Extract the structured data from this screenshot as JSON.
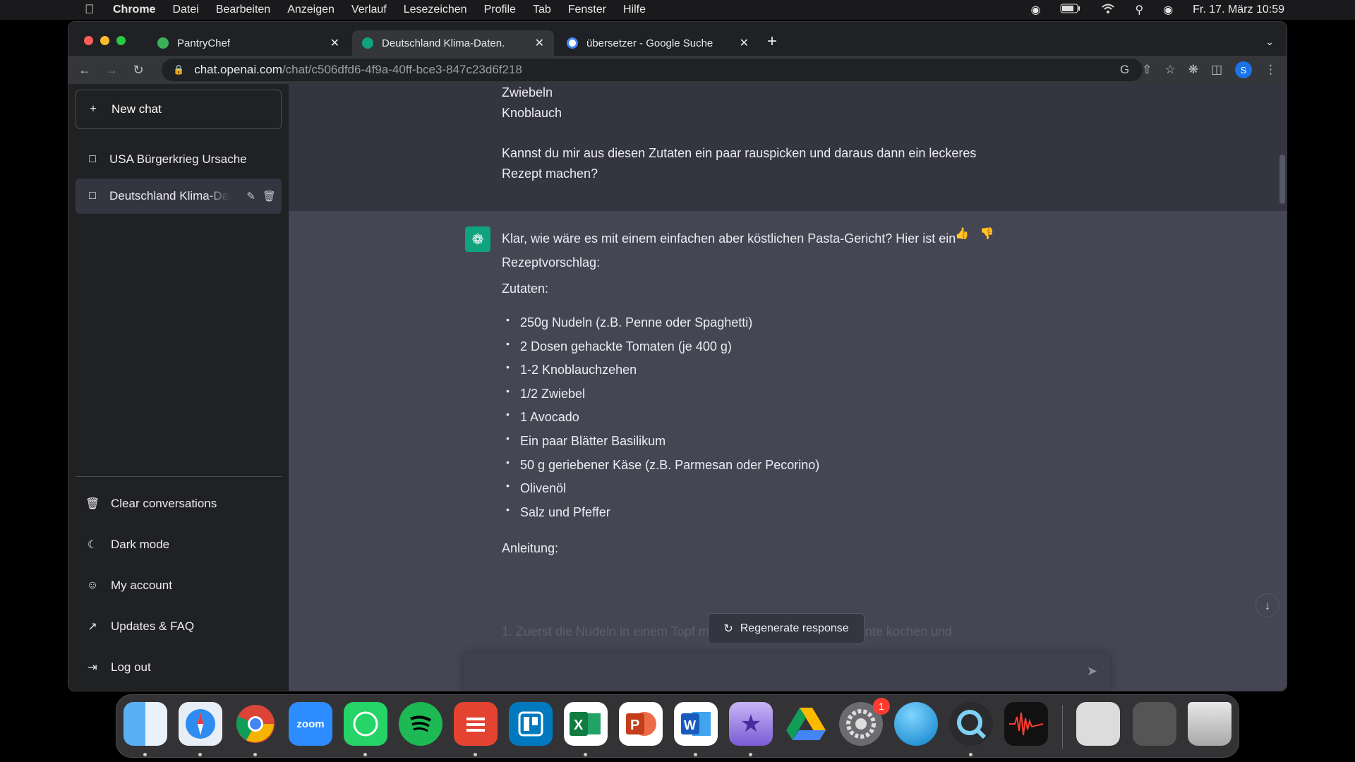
{
  "menubar": {
    "app": "Chrome",
    "menus": [
      "Datei",
      "Bearbeiten",
      "Anzeigen",
      "Verlauf",
      "Lesezeichen",
      "Profile",
      "Tab",
      "Fenster",
      "Hilfe"
    ],
    "datetime": "Fr. 17. März  10:59"
  },
  "tabs": [
    {
      "title": "PantryChef",
      "favicon_color": "#3bb05a"
    },
    {
      "title": "Deutschland Klima-Daten.",
      "favicon_color": "#10a37f"
    },
    {
      "title": "übersetzer - Google Suche",
      "favicon_color": "#ffffff"
    }
  ],
  "toolbar": {
    "url_host": "chat.openai.com",
    "url_path": "/chat/c506dfd6-4f9a-40ff-bce3-847c23d6f218",
    "profile_initial": "S"
  },
  "sidebar": {
    "new_chat": "New chat",
    "conversations": [
      "USA Bürgerkrieg Ursache",
      "Deutschland Klima-Daten."
    ],
    "items": [
      "Clear conversations",
      "Dark mode",
      "My account",
      "Updates & FAQ",
      "Log out"
    ]
  },
  "user_message": {
    "lines": [
      "Zwiebeln",
      "Knoblauch"
    ],
    "question": "Kannst du mir aus diesen Zutaten ein paar rauspicken und daraus dann ein leckeres Rezept machen?"
  },
  "assistant_message": {
    "intro": "Klar, wie wäre es mit einem einfachen aber köstlichen Pasta-Gericht? Hier ist ein Rezeptvorschlag:",
    "ingredients_heading": "Zutaten:",
    "ingredients": [
      "250g Nudeln (z.B. Penne oder Spaghetti)",
      "2 Dosen gehackte Tomaten (je 400 g)",
      "1-2 Knoblauchzehen",
      "1/2 Zwiebel",
      "1 Avocado",
      "Ein paar Blätter Basilikum",
      "50 g geriebener Käse (z.B. Parmesan oder Pecorino)",
      "Olivenöl",
      "Salz und Pfeffer"
    ],
    "instructions_heading": "Anleitung:",
    "faded_line": "1.  Zuerst die Nudeln in einem Topf mit reichlich Salzwasser al dente kochen und"
  },
  "regenerate": "Regenerate response",
  "dock": {
    "apps": [
      "finder",
      "safari",
      "chrome",
      "zoom",
      "whatsapp",
      "spotify",
      "todoist",
      "trello",
      "excel",
      "powerpoint",
      "word",
      "imovie",
      "google-drive",
      "system-settings",
      "browser",
      "quicktime",
      "voice-memos"
    ],
    "zoom_label": "zoom",
    "settings_badge": "1"
  }
}
